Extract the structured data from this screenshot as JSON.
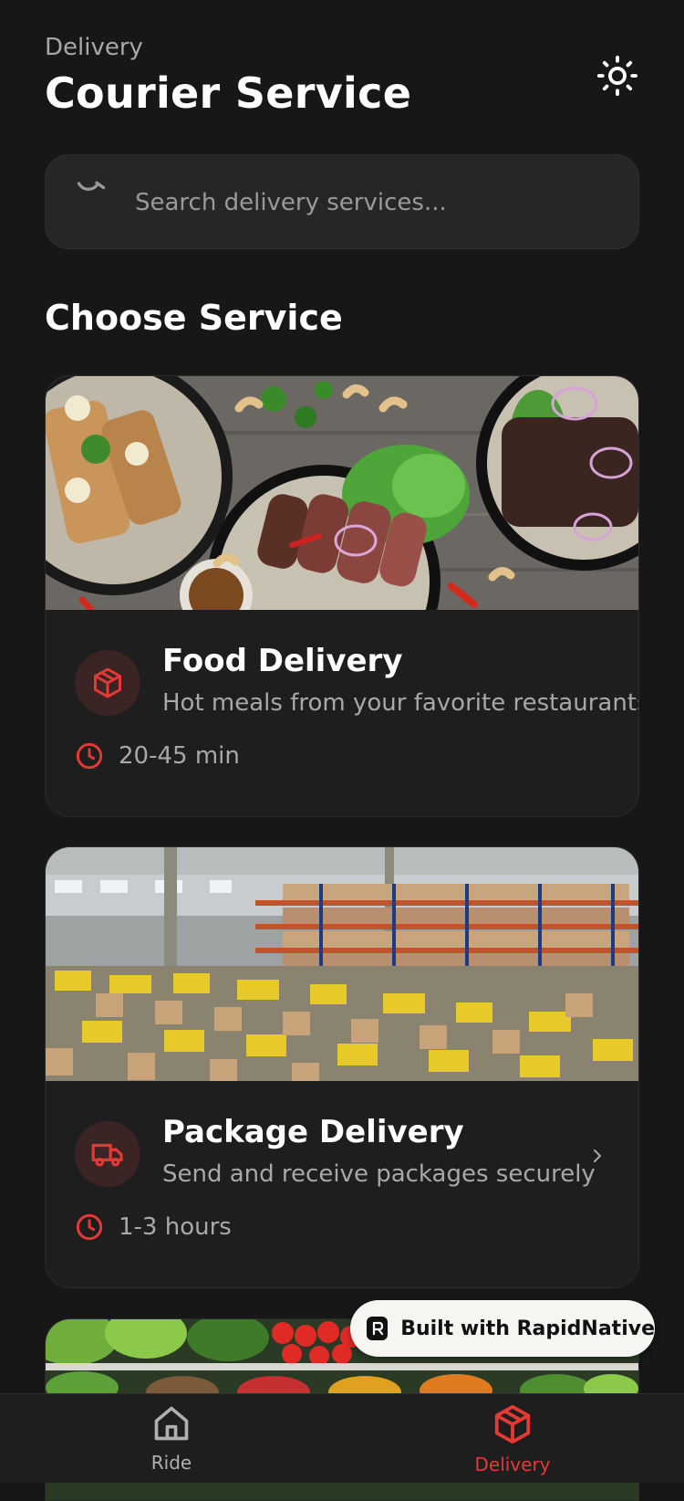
{
  "header": {
    "subtitle": "Delivery",
    "title": "Courier Service"
  },
  "search": {
    "placeholder": "Search delivery services..."
  },
  "section": {
    "title": "Choose Service"
  },
  "services": [
    {
      "name": "Food Delivery",
      "description": "Hot meals from your favorite restaurants",
      "time": "20-45 min",
      "icon": "package-icon"
    },
    {
      "name": "Package Delivery",
      "description": "Send and receive packages securely",
      "time": "1-3 hours",
      "icon": "truck-icon"
    }
  ],
  "badge": {
    "text": "Built with RapidNative"
  },
  "tabs": [
    {
      "label": "Ride",
      "icon": "home-icon",
      "active": false
    },
    {
      "label": "Delivery",
      "icon": "package-icon",
      "active": true
    }
  ],
  "colors": {
    "background": "#171717",
    "card": "#1e1e1e",
    "accent": "#e53935",
    "muted": "#a8a8a8"
  }
}
